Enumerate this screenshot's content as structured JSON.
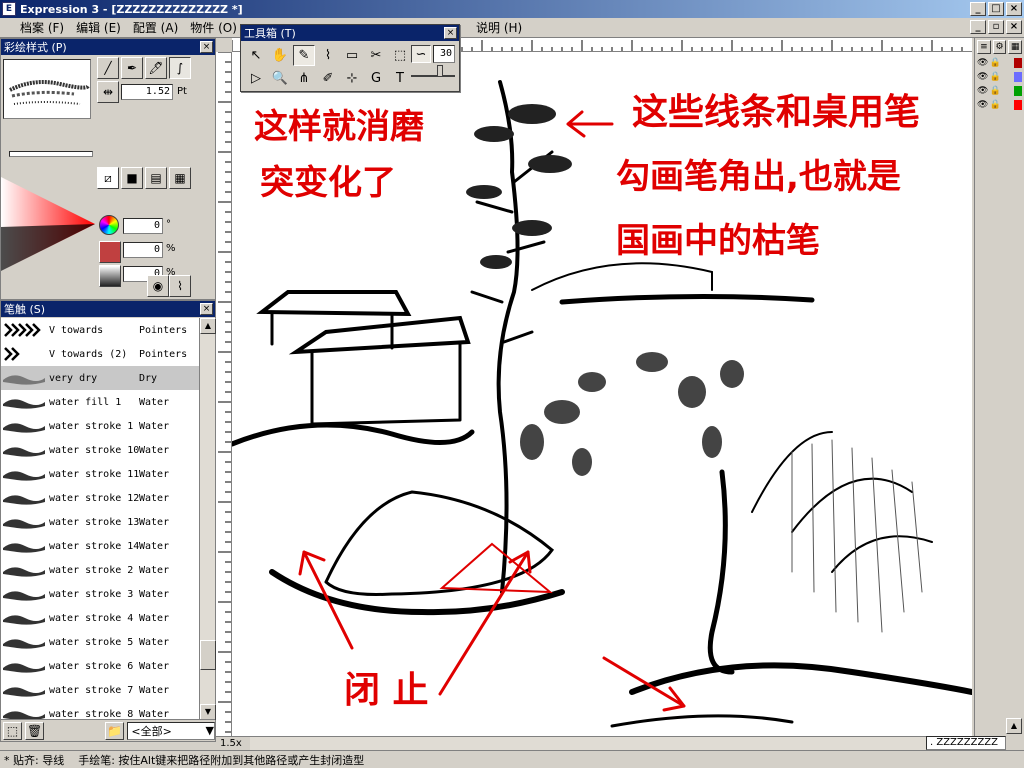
{
  "window": {
    "title": "Expression 3 - [ZZZZZZZZZZZZZZ *]"
  },
  "menu": [
    "档案 (F)",
    "编辑 (E)",
    "配置 (A)",
    "物件 (O)"
  ],
  "menu_help": "说明 (H)",
  "style_panel": {
    "title": "彩绘样式 (P)",
    "width_value": "1.52",
    "width_unit": "Pt",
    "hue_value": "0",
    "hue_unit": "°",
    "opacity_value": "0",
    "opacity_unit": "%",
    "lightness_value": "0",
    "lightness_unit": "%"
  },
  "toolbox": {
    "title": "工具箱 (T)",
    "size_value": "30"
  },
  "brush_panel": {
    "title": "笔触 (S)",
    "filter": "<全部>",
    "items": [
      {
        "name": "V towards",
        "category": "Pointers"
      },
      {
        "name": "V towards (2)",
        "category": "Pointers"
      },
      {
        "name": "very dry",
        "category": "Dry"
      },
      {
        "name": "water fill 1",
        "category": "Water"
      },
      {
        "name": "water stroke 1",
        "category": "Water"
      },
      {
        "name": "water stroke 10",
        "category": "Water"
      },
      {
        "name": "water stroke 11",
        "category": "Water"
      },
      {
        "name": "water stroke 12",
        "category": "Water"
      },
      {
        "name": "water stroke 13",
        "category": "Water"
      },
      {
        "name": "water stroke 14",
        "category": "Water"
      },
      {
        "name": "water stroke 2",
        "category": "Water"
      },
      {
        "name": "water stroke 3",
        "category": "Water"
      },
      {
        "name": "water stroke 4",
        "category": "Water"
      },
      {
        "name": "water stroke 5",
        "category": "Water"
      },
      {
        "name": "water stroke 6",
        "category": "Water"
      },
      {
        "name": "water stroke 7",
        "category": "Water"
      },
      {
        "name": "water stroke 8",
        "category": "Water"
      }
    ]
  },
  "canvas": {
    "zoom": "1.5x",
    "doc_name": ". ZZZZZZZZZ",
    "annotations": {
      "top_left_line1": "这样就消磨",
      "top_left_line2": "突变化了",
      "top_right_line1": "这些线条和桌用笔",
      "top_right_line2": "勾画笔角出,也就是",
      "top_right_line3": "国画中的枯笔",
      "bottom": "闭 止"
    }
  },
  "layers": {
    "colors": [
      "#b00000",
      "#6c6cff",
      "#00a000",
      "#ff0000"
    ]
  },
  "status": {
    "left": "* 贴齐: 导线",
    "right": "手绘笔: 按住Alt键来把路径附加到其他路径或产生封闭造型"
  }
}
